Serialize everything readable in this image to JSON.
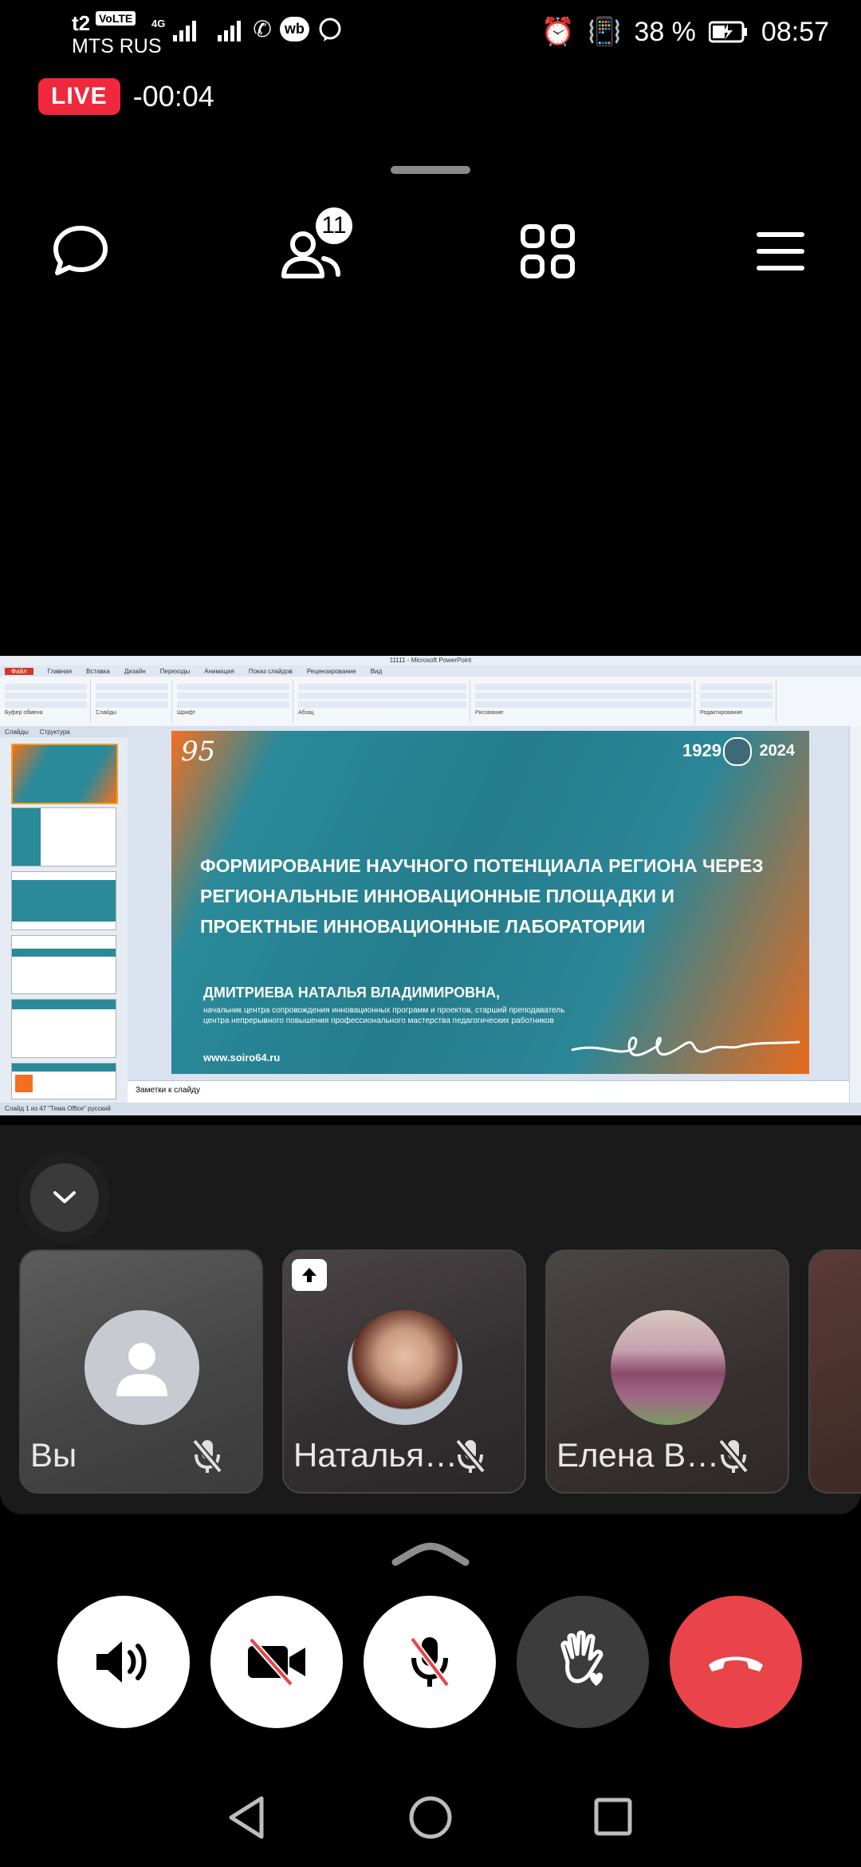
{
  "status_bar": {
    "carrier_line1": "t2",
    "volte": "VoLTE",
    "net_type": "4G",
    "carrier_line2": "MTS RUS",
    "battery": "38 %",
    "time": "08:57",
    "wb": "wb"
  },
  "live": {
    "label": "LIVE",
    "timer": "-00:04"
  },
  "topbar": {
    "participants_count": "11"
  },
  "shared_screen": {
    "window_title": "11111 - Microsoft PowerPoint",
    "tabs": [
      "Файл",
      "Главная",
      "Вставка",
      "Дизайн",
      "Переходы",
      "Анимация",
      "Показ слайдов",
      "Рецензирование",
      "Вид"
    ],
    "ribbon_groups": [
      "Буфер обмена",
      "Слайды",
      "Шрифт",
      "Абзац",
      "Рисование",
      "Редактирование"
    ],
    "left_tabs": [
      "Слайды",
      "Структура"
    ],
    "slide": {
      "year_left": "1929",
      "year_right": "2024",
      "headline": "ФОРМИРОВАНИЕ НАУЧНОГО ПОТЕНЦИАЛА РЕГИОНА ЧЕРЕЗ РЕГИОНАЛЬНЫЕ ИННОВАЦИОННЫЕ ПЛОЩАДКИ И ПРОЕКТНЫЕ ИННОВАЦИОННЫЕ ЛАБОРАТОРИИ",
      "author": "ДМИТРИЕВА НАТАЛЬЯ ВЛАДИМИРОВНА,",
      "role": "начальник центра сопровождения инновационных программ и проектов, старший преподаватель центра непрерывного повышения профессионального мастерства педагогических работников",
      "site": "www.soiro64.ru"
    },
    "notes_placeholder": "Заметки к слайду",
    "status_text": "Слайд 1 из 47   \"Тема Office\"   русский"
  },
  "participants": [
    {
      "name": "Вы",
      "muted": true
    },
    {
      "name": "Наталья…",
      "muted": true,
      "sharing": true
    },
    {
      "name": "Елена В…",
      "muted": true
    }
  ],
  "colors": {
    "live": "#f0283c",
    "end_call": "#e8444a",
    "panel": "#1a1a1a"
  }
}
